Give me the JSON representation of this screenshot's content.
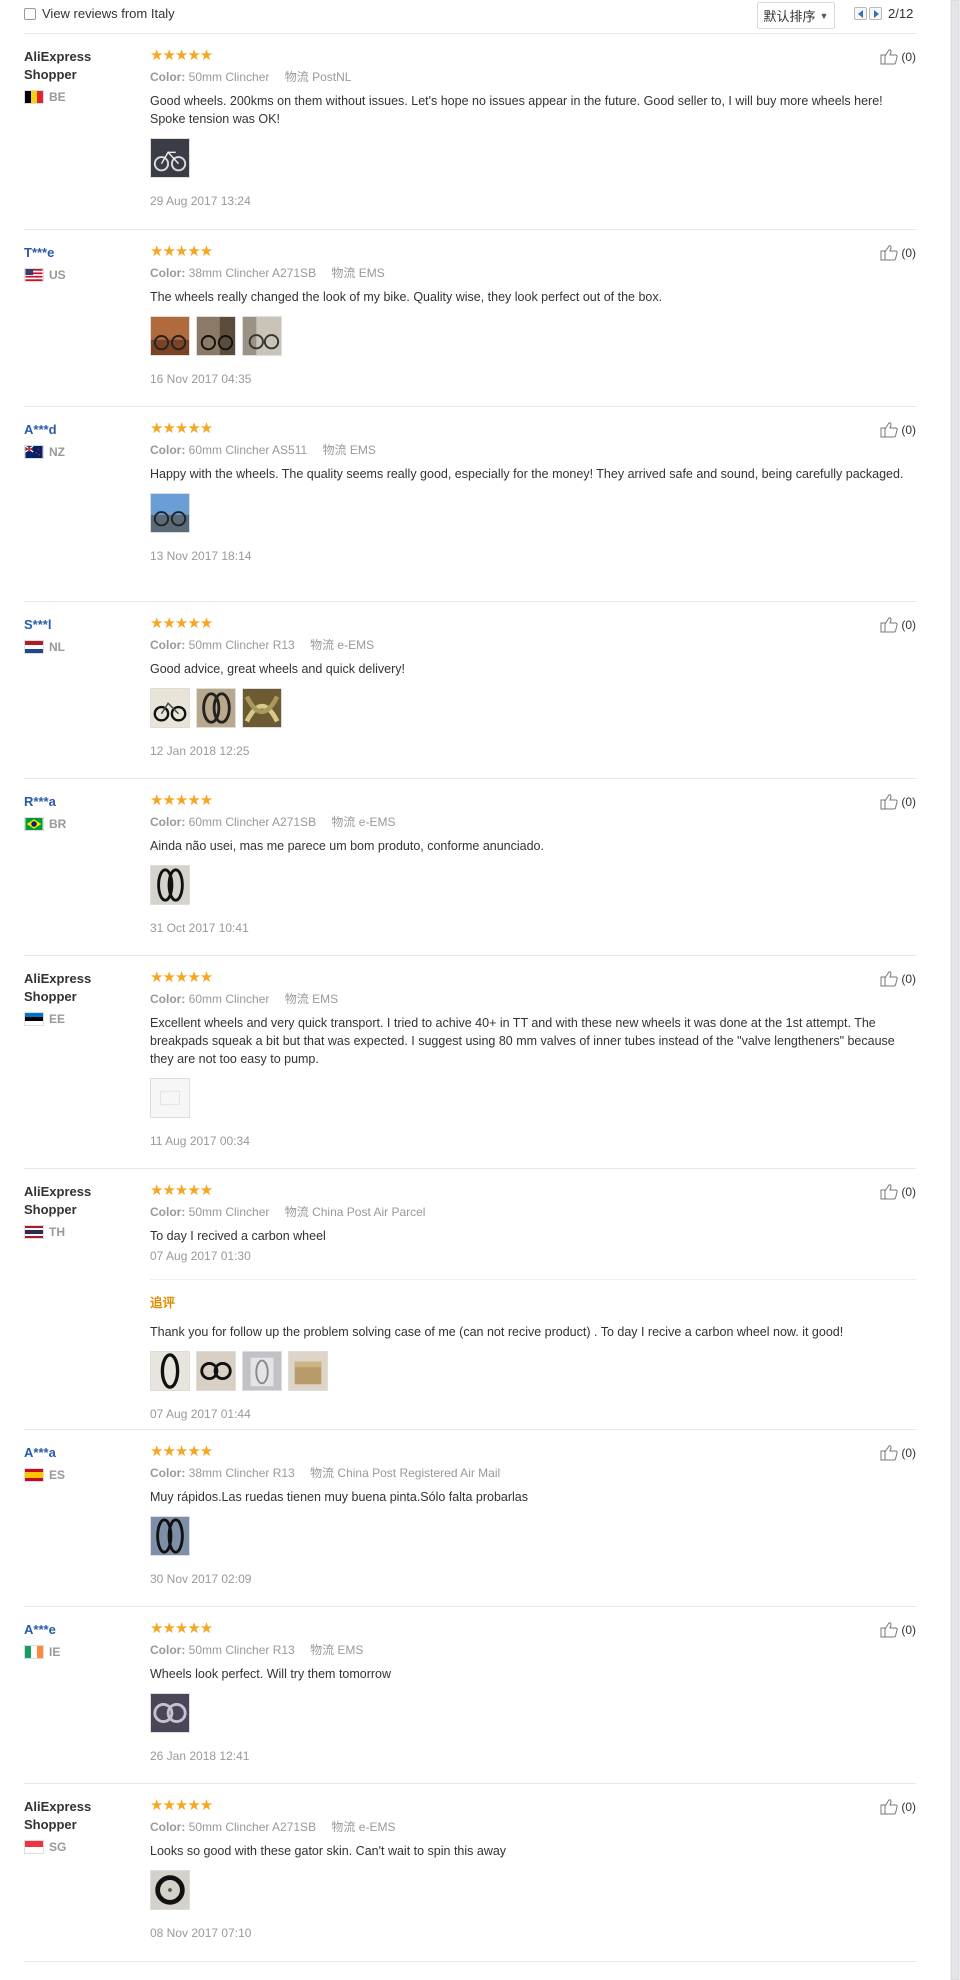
{
  "filter": {
    "label": "View reviews from Italy"
  },
  "sort": {
    "label": "默认排序"
  },
  "pager": {
    "text": "2/12"
  },
  "icons": {
    "like": "thumb-up-icon",
    "chevron": "chevron-down-icon",
    "prev": "prev-page-icon",
    "next": "next-page-icon"
  },
  "colors": {
    "star": "#f5a623",
    "masked_name": "#2a5aa8",
    "follow_up": "#e48c00"
  },
  "reviews": [
    {
      "name": "AliExpress Shopper",
      "country": "BE",
      "stars": "★★★★★",
      "color_label": "Color:",
      "color": "50mm Clincher",
      "ship_label": "物流",
      "ship": "PostNL",
      "text": "Good wheels. 200kms on them without issues. Let's hope no issues appear in the future. Good seller to, I will buy more wheels here! Spoke tension was OK!",
      "date": "29 Aug 2017 13:24",
      "likes": "(0)"
    },
    {
      "name": "T***e",
      "country": "US",
      "stars": "★★★★★",
      "color_label": "Color:",
      "color": "38mm Clincher A271SB",
      "ship_label": "物流",
      "ship": "EMS",
      "text": "The wheels really changed the look of my bike. Quality wise, they look perfect out of the box.",
      "date": "16 Nov 2017 04:35",
      "likes": "(0)"
    },
    {
      "name": "A***d",
      "country": "NZ",
      "stars": "★★★★★",
      "color_label": "Color:",
      "color": "60mm Clincher AS511",
      "ship_label": "物流",
      "ship": "EMS",
      "text": "Happy with the wheels. The quality seems really good, especially for the money! They arrived safe and sound, being carefully packaged.",
      "date": "13 Nov 2017 18:14",
      "likes": "(0)"
    },
    {
      "name": "S***l",
      "country": "NL",
      "stars": "★★★★★",
      "color_label": "Color:",
      "color": "50mm Clincher R13",
      "ship_label": "物流",
      "ship": "e-EMS",
      "text": "Good advice, great wheels and quick delivery!",
      "date": "12 Jan 2018 12:25",
      "likes": "(0)"
    },
    {
      "name": "R***a",
      "country": "BR",
      "stars": "★★★★★",
      "color_label": "Color:",
      "color": "60mm Clincher A271SB",
      "ship_label": "物流",
      "ship": "e-EMS",
      "text": "Ainda não usei, mas me parece um bom produto, conforme anunciado.",
      "date": "31 Oct 2017 10:41",
      "likes": "(0)"
    },
    {
      "name": "AliExpress Shopper",
      "country": "EE",
      "stars": "★★★★★",
      "color_label": "Color:",
      "color": "60mm Clincher",
      "ship_label": "物流",
      "ship": "EMS",
      "text": "Excellent wheels and very quick transport. I tried to achive 40+ in TT and with these new wheels it was done at the 1st attempt. The breakpads squeak a bit but that was expected. I suggest using 80 mm valves of inner tubes instead of the \"valve lengtheners\" because they are not too easy to pump.",
      "date": "11 Aug 2017 00:34",
      "likes": "(0)"
    },
    {
      "name": "AliExpress Shopper",
      "country": "TH",
      "stars": "★★★★★",
      "color_label": "Color:",
      "color": "50mm Clincher",
      "ship_label": "物流",
      "ship": "China Post Air Parcel",
      "text": "To day I recived a carbon wheel",
      "date": "07 Aug 2017 01:30",
      "likes": "(0)",
      "follow_label": "追评",
      "follow_text": "Thank you for follow up the problem solving case of me (can not recive product) . To day I recive a carbon wheel now. it good!",
      "follow_date": "07 Aug 2017 01:44"
    },
    {
      "name": "A***a",
      "country": "ES",
      "stars": "★★★★★",
      "color_label": "Color:",
      "color": "38mm Clincher R13",
      "ship_label": "物流",
      "ship": "China Post Registered Air Mail",
      "text": "Muy rápidos.Las ruedas tienen muy buena pinta.Sólo falta probarlas",
      "date": "30 Nov 2017 02:09",
      "likes": "(0)"
    },
    {
      "name": "A***e",
      "country": "IE",
      "stars": "★★★★★",
      "color_label": "Color:",
      "color": "50mm Clincher R13",
      "ship_label": "物流",
      "ship": "EMS",
      "text": "Wheels look perfect. Will try them tomorrow",
      "date": "26 Jan 2018 12:41",
      "likes": "(0)"
    },
    {
      "name": "AliExpress Shopper",
      "country": "SG",
      "stars": "★★★★★",
      "color_label": "Color:",
      "color": "50mm Clincher A271SB",
      "ship_label": "物流",
      "ship": "e-EMS",
      "text": "Looks so good with these gator skin. Can't wait to spin this away",
      "date": "08 Nov 2017 07:10",
      "likes": "(0)"
    }
  ]
}
